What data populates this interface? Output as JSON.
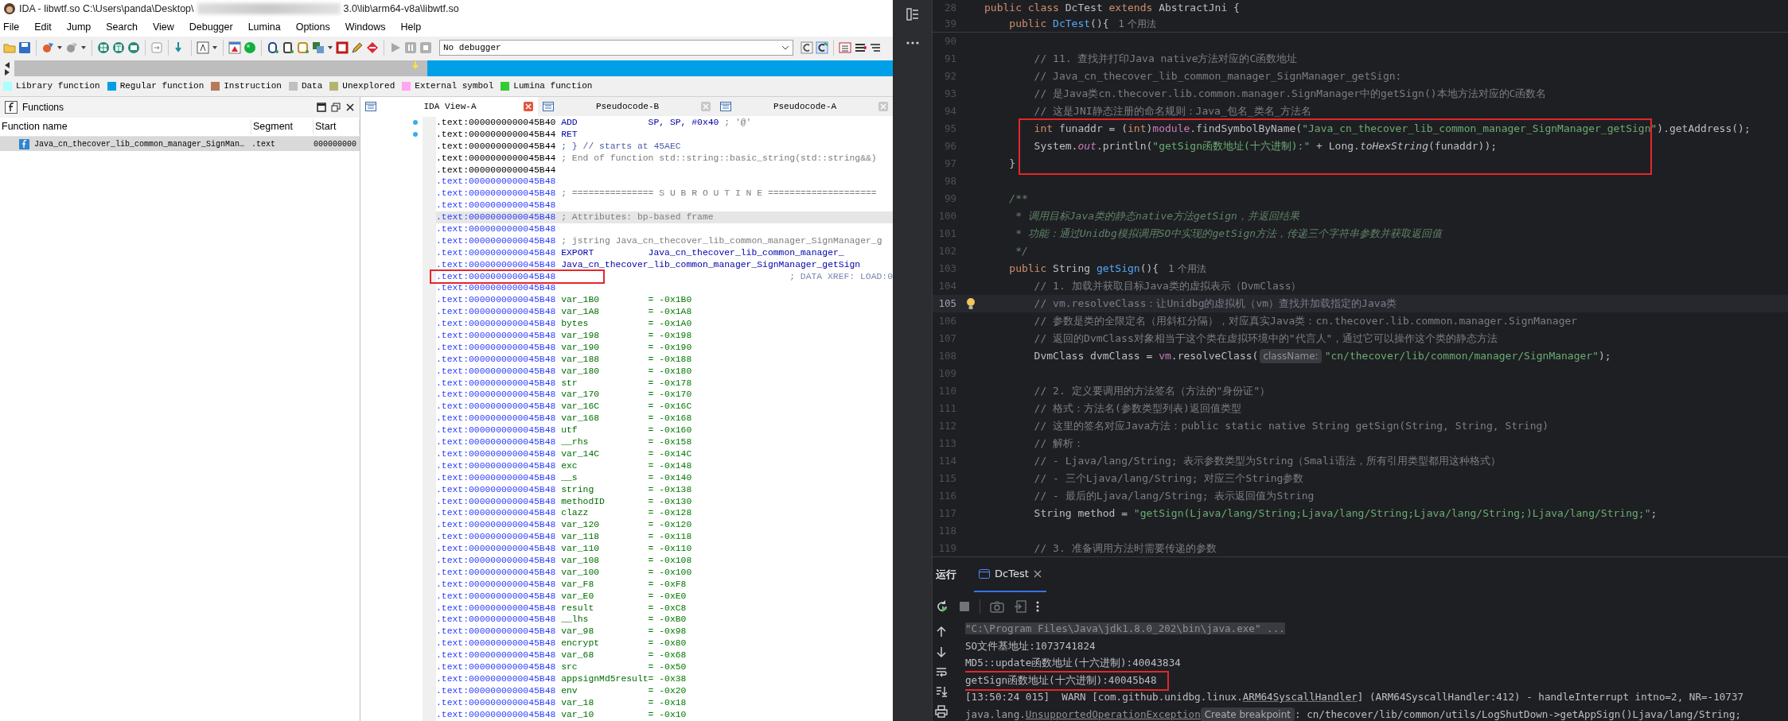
{
  "ida": {
    "title_start": "IDA - libwtf.so C:\\Users\\panda\\Desktop\\",
    "title_end": "3.0\\lib\\arm64-v8a\\libwtf.so",
    "menu": [
      "File",
      "Edit",
      "Jump",
      "Search",
      "View",
      "Debugger",
      "Lumina",
      "Options",
      "Windows",
      "Help"
    ],
    "debugger_select": "No debugger",
    "legend": [
      {
        "label": "Library function",
        "color": "#aaffff"
      },
      {
        "label": "Regular function",
        "color": "#009fe3"
      },
      {
        "label": "Instruction",
        "color": "#b57a5a"
      },
      {
        "label": "Data",
        "color": "#c0c0c0"
      },
      {
        "label": "Unexplored",
        "color": "#b4b46e"
      },
      {
        "label": "External symbol",
        "color": "#ffa6f0"
      },
      {
        "label": "Lumina function",
        "color": "#33cc33"
      }
    ],
    "functions_panel": {
      "title": "Functions",
      "columns": [
        "Function name",
        "Segment",
        "Start"
      ],
      "rows": [
        {
          "cells": [
            "Java_cn_thecover_lib_common_manager_SignMan…",
            ".text",
            "000000000"
          ],
          "selected": true
        }
      ]
    },
    "view_tabs": [
      {
        "label": "IDA View-A",
        "selected": true
      },
      {
        "label": "Pseudocode-B",
        "selected": false
      },
      {
        "label": "Pseudocode-A",
        "selected": false
      }
    ],
    "lines": [
      {
        "address": ".text:0000000000045B40",
        "in_function": false,
        "marked": true,
        "highlighted": false,
        "boxed": false,
        "kind": "instruction",
        "mnemonic": "ADD",
        "operands": "SP, SP, #0x40",
        "comment": "; '@'"
      },
      {
        "address": ".text:0000000000045B44",
        "in_function": false,
        "marked": true,
        "highlighted": false,
        "boxed": false,
        "kind": "instruction",
        "mnemonic": "RET"
      },
      {
        "address": ".text:0000000000045B44",
        "in_function": false,
        "marked": false,
        "highlighted": false,
        "boxed": false,
        "kind": "comment",
        "text": "; } // starts at 45AEC"
      },
      {
        "address": ".text:0000000000045B44",
        "in_function": false,
        "marked": false,
        "highlighted": false,
        "boxed": false,
        "kind": "comment",
        "text": "; End of function std::string::basic_string(std::string&&)"
      },
      {
        "address": ".text:0000000000045B44",
        "in_function": false,
        "marked": false,
        "highlighted": false,
        "boxed": false,
        "kind": "blank"
      },
      {
        "address": ".text:0000000000045B48",
        "in_function": true,
        "marked": false,
        "highlighted": false,
        "boxed": false,
        "kind": "blank"
      },
      {
        "address": ".text:0000000000045B48",
        "in_function": true,
        "marked": false,
        "highlighted": false,
        "boxed": false,
        "kind": "comment",
        "text": "; =============== S U B R O U T I N E ===================="
      },
      {
        "address": ".text:0000000000045B48",
        "in_function": true,
        "marked": false,
        "highlighted": false,
        "boxed": false,
        "kind": "blank"
      },
      {
        "address": ".text:0000000000045B48",
        "in_function": true,
        "marked": false,
        "highlighted": true,
        "boxed": false,
        "kind": "comment",
        "text": "; Attributes: bp-based frame"
      },
      {
        "address": ".text:0000000000045B48",
        "in_function": true,
        "marked": false,
        "highlighted": false,
        "boxed": false,
        "kind": "blank"
      },
      {
        "address": ".text:0000000000045B48",
        "in_function": true,
        "marked": false,
        "highlighted": false,
        "boxed": false,
        "kind": "comment",
        "text": "; jstring Java_cn_thecover_lib_common_manager_SignManager_g"
      },
      {
        "address": ".text:0000000000045B48",
        "in_function": true,
        "marked": false,
        "highlighted": false,
        "boxed": false,
        "kind": "directive",
        "mnemonic": "EXPORT",
        "operands": "Java_cn_thecover_lib_common_manager_"
      },
      {
        "address": ".text:0000000000045B48",
        "in_function": true,
        "marked": false,
        "highlighted": false,
        "boxed": false,
        "kind": "label",
        "text": "Java_cn_thecover_lib_common_manager_SignManager_getSign"
      },
      {
        "address": ".text:0000000000045B48",
        "in_function": true,
        "marked": false,
        "highlighted": false,
        "boxed": true,
        "kind": "xref",
        "text": "; DATA XREF: LOAD:0"
      },
      {
        "address": ".text:0000000000045B48",
        "in_function": true,
        "marked": false,
        "highlighted": false,
        "boxed": false,
        "kind": "blank"
      },
      {
        "address": ".text:0000000000045B48",
        "in_function": true,
        "marked": false,
        "highlighted": false,
        "boxed": false,
        "kind": "stackvar",
        "name": "var_1B0",
        "offset": "= -0x1B0"
      },
      {
        "address": ".text:0000000000045B48",
        "in_function": true,
        "marked": false,
        "highlighted": false,
        "boxed": false,
        "kind": "stackvar",
        "name": "var_1A8",
        "offset": "= -0x1A8"
      },
      {
        "address": ".text:0000000000045B48",
        "in_function": true,
        "marked": false,
        "highlighted": false,
        "boxed": false,
        "kind": "stackvar",
        "name": "bytes",
        "offset": "= -0x1A0"
      },
      {
        "address": ".text:0000000000045B48",
        "in_function": true,
        "marked": false,
        "highlighted": false,
        "boxed": false,
        "kind": "stackvar",
        "name": "var_198",
        "offset": "= -0x198"
      },
      {
        "address": ".text:0000000000045B48",
        "in_function": true,
        "marked": false,
        "highlighted": false,
        "boxed": false,
        "kind": "stackvar",
        "name": "var_190",
        "offset": "= -0x190"
      },
      {
        "address": ".text:0000000000045B48",
        "in_function": true,
        "marked": false,
        "highlighted": false,
        "boxed": false,
        "kind": "stackvar",
        "name": "var_188",
        "offset": "= -0x188"
      },
      {
        "address": ".text:0000000000045B48",
        "in_function": true,
        "marked": false,
        "highlighted": false,
        "boxed": false,
        "kind": "stackvar",
        "name": "var_180",
        "offset": "= -0x180"
      },
      {
        "address": ".text:0000000000045B48",
        "in_function": true,
        "marked": false,
        "highlighted": false,
        "boxed": false,
        "kind": "stackvar",
        "name": "str",
        "offset": "= -0x178"
      },
      {
        "address": ".text:0000000000045B48",
        "in_function": true,
        "marked": false,
        "highlighted": false,
        "boxed": false,
        "kind": "stackvar",
        "name": "var_170",
        "offset": "= -0x170"
      },
      {
        "address": ".text:0000000000045B48",
        "in_function": true,
        "marked": false,
        "highlighted": false,
        "boxed": false,
        "kind": "stackvar",
        "name": "var_16C",
        "offset": "= -0x16C"
      },
      {
        "address": ".text:0000000000045B48",
        "in_function": true,
        "marked": false,
        "highlighted": false,
        "boxed": false,
        "kind": "stackvar",
        "name": "var_168",
        "offset": "= -0x168"
      },
      {
        "address": ".text:0000000000045B48",
        "in_function": true,
        "marked": false,
        "highlighted": false,
        "boxed": false,
        "kind": "stackvar",
        "name": "utf",
        "offset": "= -0x160"
      },
      {
        "address": ".text:0000000000045B48",
        "in_function": true,
        "marked": false,
        "highlighted": false,
        "boxed": false,
        "kind": "stackvar",
        "name": "__rhs",
        "offset": "= -0x158"
      },
      {
        "address": ".text:0000000000045B48",
        "in_function": true,
        "marked": false,
        "highlighted": false,
        "boxed": false,
        "kind": "stackvar",
        "name": "var_14C",
        "offset": "= -0x14C"
      },
      {
        "address": ".text:0000000000045B48",
        "in_function": true,
        "marked": false,
        "highlighted": false,
        "boxed": false,
        "kind": "stackvar",
        "name": "exc",
        "offset": "= -0x148"
      },
      {
        "address": ".text:0000000000045B48",
        "in_function": true,
        "marked": false,
        "highlighted": false,
        "boxed": false,
        "kind": "stackvar",
        "name": "__s",
        "offset": "= -0x140"
      },
      {
        "address": ".text:0000000000045B48",
        "in_function": true,
        "marked": false,
        "highlighted": false,
        "boxed": false,
        "kind": "stackvar",
        "name": "string",
        "offset": "= -0x138"
      },
      {
        "address": ".text:0000000000045B48",
        "in_function": true,
        "marked": false,
        "highlighted": false,
        "boxed": false,
        "kind": "stackvar",
        "name": "methodID",
        "offset": "= -0x130"
      },
      {
        "address": ".text:0000000000045B48",
        "in_function": true,
        "marked": false,
        "highlighted": false,
        "boxed": false,
        "kind": "stackvar",
        "name": "clazz",
        "offset": "= -0x128"
      },
      {
        "address": ".text:0000000000045B48",
        "in_function": true,
        "marked": false,
        "highlighted": false,
        "boxed": false,
        "kind": "stackvar",
        "name": "var_120",
        "offset": "= -0x120"
      },
      {
        "address": ".text:0000000000045B48",
        "in_function": true,
        "marked": false,
        "highlighted": false,
        "boxed": false,
        "kind": "stackvar",
        "name": "var_118",
        "offset": "= -0x118"
      },
      {
        "address": ".text:0000000000045B48",
        "in_function": true,
        "marked": false,
        "highlighted": false,
        "boxed": false,
        "kind": "stackvar",
        "name": "var_110",
        "offset": "= -0x110"
      },
      {
        "address": ".text:0000000000045B48",
        "in_function": true,
        "marked": false,
        "highlighted": false,
        "boxed": false,
        "kind": "stackvar",
        "name": "var_108",
        "offset": "= -0x108"
      },
      {
        "address": ".text:0000000000045B48",
        "in_function": true,
        "marked": false,
        "highlighted": false,
        "boxed": false,
        "kind": "stackvar",
        "name": "var_100",
        "offset": "= -0x100"
      },
      {
        "address": ".text:0000000000045B48",
        "in_function": true,
        "marked": false,
        "highlighted": false,
        "boxed": false,
        "kind": "stackvar",
        "name": "var_F8",
        "offset": "= -0xF8"
      },
      {
        "address": ".text:0000000000045B48",
        "in_function": true,
        "marked": false,
        "highlighted": false,
        "boxed": false,
        "kind": "stackvar",
        "name": "var_E0",
        "offset": "= -0xE0"
      },
      {
        "address": ".text:0000000000045B48",
        "in_function": true,
        "marked": false,
        "highlighted": false,
        "boxed": false,
        "kind": "stackvar",
        "name": "result",
        "offset": "= -0xC8"
      },
      {
        "address": ".text:0000000000045B48",
        "in_function": true,
        "marked": false,
        "highlighted": false,
        "boxed": false,
        "kind": "stackvar",
        "name": "__lhs",
        "offset": "= -0xB0"
      },
      {
        "address": ".text:0000000000045B48",
        "in_function": true,
        "marked": false,
        "highlighted": false,
        "boxed": false,
        "kind": "stackvar",
        "name": "var_98",
        "offset": "= -0x98"
      },
      {
        "address": ".text:0000000000045B48",
        "in_function": true,
        "marked": false,
        "highlighted": false,
        "boxed": false,
        "kind": "stackvar",
        "name": "encrypt",
        "offset": "= -0x80"
      },
      {
        "address": ".text:0000000000045B48",
        "in_function": true,
        "marked": false,
        "highlighted": false,
        "boxed": false,
        "kind": "stackvar",
        "name": "var_68",
        "offset": "= -0x68"
      },
      {
        "address": ".text:0000000000045B48",
        "in_function": true,
        "marked": false,
        "highlighted": false,
        "boxed": false,
        "kind": "stackvar",
        "name": "src",
        "offset": "= -0x50"
      },
      {
        "address": ".text:0000000000045B48",
        "in_function": true,
        "marked": false,
        "highlighted": false,
        "boxed": false,
        "kind": "stackvar",
        "name": "appsignMd5result",
        "offset": "= -0x38"
      },
      {
        "address": ".text:0000000000045B48",
        "in_function": true,
        "marked": false,
        "highlighted": false,
        "boxed": false,
        "kind": "stackvar",
        "name": "env",
        "offset": "= -0x20"
      },
      {
        "address": ".text:0000000000045B48",
        "in_function": true,
        "marked": false,
        "highlighted": false,
        "boxed": false,
        "kind": "stackvar",
        "name": "var_18",
        "offset": "= -0x18"
      },
      {
        "address": ".text:0000000000045B48",
        "in_function": true,
        "marked": false,
        "highlighted": false,
        "boxed": false,
        "kind": "stackvar",
        "name": "var_10",
        "offset": "= -0x10"
      }
    ]
  },
  "ide": {
    "sticky_lines": [
      {
        "number": "28",
        "current": false,
        "boxed": false,
        "segments": [
          {
            "text": "public class ",
            "kind": "keyword"
          },
          {
            "text": "DcTest ",
            "kind": "plain"
          },
          {
            "text": "extends ",
            "kind": "keyword"
          },
          {
            "text": "AbstractJni {",
            "kind": "plain"
          }
        ]
      },
      {
        "number": "39",
        "current": false,
        "boxed": false,
        "segments": [
          {
            "text": "    public ",
            "kind": "keyword"
          },
          {
            "text": "DcTest",
            "kind": "method"
          },
          {
            "text": "(){",
            "kind": "plain"
          },
          {
            "text": "1 个用法",
            "kind": "usage"
          }
        ]
      }
    ],
    "code_lines": [
      {
        "number": "90",
        "current": false,
        "boxed": false
      },
      {
        "number": "91",
        "current": false,
        "boxed": false,
        "segments": [
          {
            "text": "        // 11. 查找并打印Java native方法对应的C函数地址",
            "kind": "comment"
          }
        ]
      },
      {
        "number": "92",
        "current": false,
        "boxed": false,
        "segments": [
          {
            "text": "        // Java_cn_thecover_lib_common_manager_SignManager_getSign:",
            "kind": "comment"
          }
        ]
      },
      {
        "number": "93",
        "current": false,
        "boxed": false,
        "segments": [
          {
            "text": "        // 是Java类cn.thecover.lib.common.manager.SignManager中的getSign()本地方法对应的C函数名",
            "kind": "comment"
          }
        ]
      },
      {
        "number": "94",
        "current": false,
        "boxed": false,
        "segments": [
          {
            "text": "        // 这是JNI静态注册的命名规则：Java_包名_类名_方法名",
            "kind": "comment"
          }
        ]
      },
      {
        "number": "95",
        "current": false,
        "boxed": true,
        "segments": [
          {
            "text": "        int ",
            "kind": "keyword"
          },
          {
            "text": "funaddr = (",
            "kind": "plain"
          },
          {
            "text": "int",
            "kind": "keyword"
          },
          {
            "text": ")",
            "kind": "plain"
          },
          {
            "text": "module",
            "kind": "field"
          },
          {
            "text": ".findSymbolByName(",
            "kind": "plain"
          },
          {
            "text": "\"Java_cn_thecover_lib_common_manager_SignManager_getSign\"",
            "kind": "string"
          },
          {
            "text": ").getAddress();",
            "kind": "plain"
          }
        ]
      },
      {
        "number": "96",
        "current": false,
        "boxed": true,
        "segments": [
          {
            "text": "        System.",
            "kind": "plain"
          },
          {
            "text": "out",
            "kind": "static"
          },
          {
            "text": ".println(",
            "kind": "plain"
          },
          {
            "text": "\"getSign函数地址(十六进制):\"",
            "kind": "string"
          },
          {
            "text": " + Long.",
            "kind": "plain"
          },
          {
            "text": "toHexString",
            "kind": "call"
          },
          {
            "text": "(funaddr));",
            "kind": "plain"
          }
        ]
      },
      {
        "number": "97",
        "current": false,
        "boxed": true,
        "segments": [
          {
            "text": "    }",
            "kind": "plain"
          }
        ]
      },
      {
        "number": "98",
        "current": false,
        "boxed": false
      },
      {
        "number": "99",
        "current": false,
        "boxed": false,
        "segments": [
          {
            "text": "    /**",
            "kind": "doc"
          }
        ]
      },
      {
        "number": "100",
        "current": false,
        "boxed": false,
        "segments": [
          {
            "text": "     * 调用目标Java类的静态native方法getSign，并返回结果",
            "kind": "doc"
          }
        ]
      },
      {
        "number": "101",
        "current": false,
        "boxed": false,
        "segments": [
          {
            "text": "     * 功能：通过Unidbg模拟调用SO中实现的getSign方法，传递三个字符串参数并获取返回值",
            "kind": "doc"
          }
        ]
      },
      {
        "number": "102",
        "current": false,
        "boxed": false,
        "segments": [
          {
            "text": "     */",
            "kind": "doc"
          }
        ]
      },
      {
        "number": "103",
        "current": false,
        "boxed": false,
        "segments": [
          {
            "text": "    public ",
            "kind": "keyword"
          },
          {
            "text": "String ",
            "kind": "plain"
          },
          {
            "text": "getSign",
            "kind": "method"
          },
          {
            "text": "(){",
            "kind": "plain"
          },
          {
            "text": "1 个用法",
            "kind": "usage"
          }
        ]
      },
      {
        "number": "104",
        "current": false,
        "boxed": false,
        "segments": [
          {
            "text": "        // 1. 加载并获取目标Java类的虚拟表示（DvmClass）",
            "kind": "comment"
          }
        ]
      },
      {
        "number": "105",
        "current": true,
        "boxed": false,
        "segments": [
          {
            "text": "        // vm.resolveClass：让Unidbg的虚拟机（vm）查找并加载指定的Java类",
            "kind": "comment"
          }
        ]
      },
      {
        "number": "106",
        "current": false,
        "boxed": false,
        "segments": [
          {
            "text": "        // 参数是类的全限定名（用斜杠分隔），对应真实Java类：cn.thecover.lib.common.manager.SignManager",
            "kind": "comment"
          }
        ]
      },
      {
        "number": "107",
        "current": false,
        "boxed": false,
        "segments": [
          {
            "text": "        // 返回的DvmClass对象相当于这个类在虚拟环境中的\"代言人\"，通过它可以操作这个类的静态方法",
            "kind": "comment"
          }
        ]
      },
      {
        "number": "108",
        "current": false,
        "boxed": false,
        "segments": [
          {
            "text": "        DvmClass dvmClass = ",
            "kind": "plain"
          },
          {
            "text": "vm",
            "kind": "field"
          },
          {
            "text": ".resolveClass(",
            "kind": "plain"
          },
          {
            "text": "className:",
            "kind": "hint"
          },
          {
            "text": "\"cn/thecover/lib/common/manager/SignManager\"",
            "kind": "string"
          },
          {
            "text": ");",
            "kind": "plain"
          }
        ]
      },
      {
        "number": "109",
        "current": false,
        "boxed": false
      },
      {
        "number": "110",
        "current": false,
        "boxed": false,
        "segments": [
          {
            "text": "        // 2. 定义要调用的方法签名（方法的\"身份证\"）",
            "kind": "comment"
          }
        ]
      },
      {
        "number": "111",
        "current": false,
        "boxed": false,
        "segments": [
          {
            "text": "        // 格式：方法名(参数类型列表)返回值类型",
            "kind": "comment"
          }
        ]
      },
      {
        "number": "112",
        "current": false,
        "boxed": false,
        "segments": [
          {
            "text": "        // 这里的签名对应Java方法：public static native String getSign(String, String, String)",
            "kind": "comment"
          }
        ]
      },
      {
        "number": "113",
        "current": false,
        "boxed": false,
        "segments": [
          {
            "text": "        // 解析：",
            "kind": "comment"
          }
        ]
      },
      {
        "number": "114",
        "current": false,
        "boxed": false,
        "segments": [
          {
            "text": "        // - Ljava/lang/String; 表示参数类型为String（Smali语法，所有引用类型都用这种格式）",
            "kind": "comment"
          }
        ]
      },
      {
        "number": "115",
        "current": false,
        "boxed": false,
        "segments": [
          {
            "text": "        // - 三个Ljava/lang/String; 对应三个String参数",
            "kind": "comment"
          }
        ]
      },
      {
        "number": "116",
        "current": false,
        "boxed": false,
        "segments": [
          {
            "text": "        // - 最后的Ljava/lang/String; 表示返回值为String",
            "kind": "comment"
          }
        ]
      },
      {
        "number": "117",
        "current": false,
        "boxed": false,
        "segments": [
          {
            "text": "        String method = ",
            "kind": "plain"
          },
          {
            "text": "\"getSign(Ljava/lang/String;Ljava/lang/String;Ljava/lang/String;)Ljava/lang/String;\"",
            "kind": "string"
          },
          {
            "text": ";",
            "kind": "plain"
          }
        ]
      },
      {
        "number": "118",
        "current": false,
        "boxed": false
      },
      {
        "number": "119",
        "current": false,
        "boxed": false,
        "segments": [
          {
            "text": "        // 3. 准备调用方法时需要传递的参数",
            "kind": "comment"
          }
        ]
      }
    ],
    "run_panel": {
      "title": "运行",
      "tabs": [
        {
          "label": "DcTest",
          "selected": true
        }
      ],
      "output": [
        {
          "boxed": false,
          "parts": [
            {
              "text": "\"C:\\Program Files\\Java\\jdk1.8.0_202\\bin\\java.exe\" ...",
              "kind": "command"
            }
          ]
        },
        {
          "boxed": false,
          "parts": [
            {
              "text": "SO文件基地址:1073741824",
              "kind": "plain"
            }
          ]
        },
        {
          "boxed": false,
          "parts": [
            {
              "text": "MD5::update函数地址(十六进制):40043834",
              "kind": "plain"
            }
          ]
        },
        {
          "boxed": true,
          "parts": [
            {
              "text": "getSign函数地址(十六进制):40045b48",
              "kind": "plain"
            }
          ]
        },
        {
          "boxed": false,
          "parts": [
            {
              "text": "[13:50:24 015]  WARN [com.github.unidbg.linux.",
              "kind": "plain"
            },
            {
              "text": "ARM64SyscallHandler",
              "kind": "link"
            },
            {
              "text": "] (ARM64SyscallHandler:412) - handleInterrupt intno=2, NR=-10737",
              "kind": "plain"
            }
          ]
        },
        {
          "boxed": false,
          "parts": [
            {
              "text": "java.lang.",
              "kind": "muted"
            },
            {
              "text": "UnsupportedOperationException",
              "kind": "exception"
            },
            {
              "text": "Create breakpoint",
              "kind": "hint"
            },
            {
              "text": ": cn/thecover/lib/common/utils/LogShutDown->getAppSign()Ljava/lang/String;",
              "kind": "plain"
            }
          ]
        }
      ]
    }
  }
}
